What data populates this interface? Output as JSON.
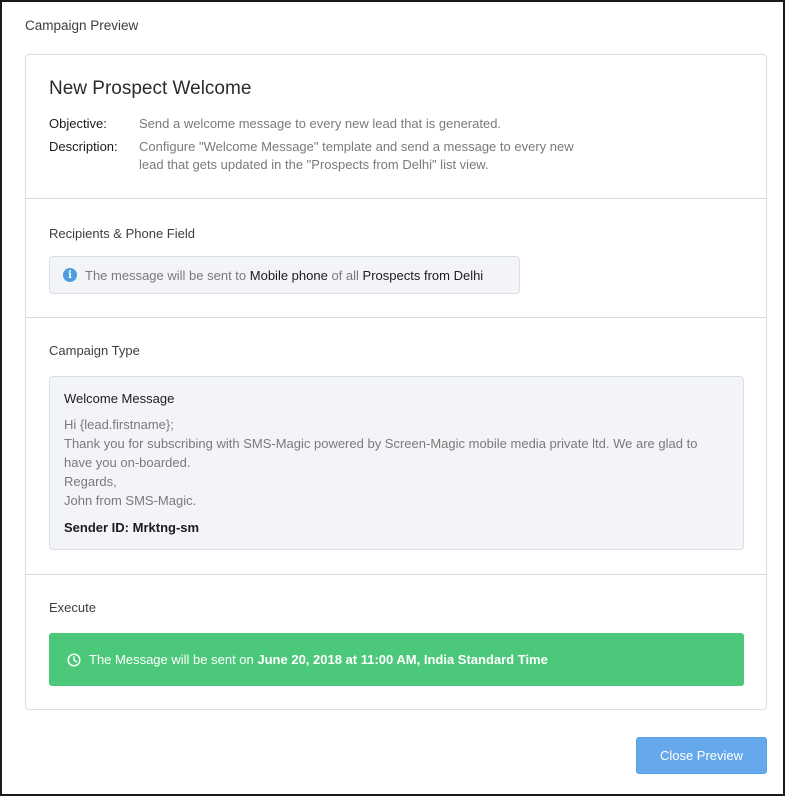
{
  "modal": {
    "title": "Campaign Preview"
  },
  "campaign": {
    "name": "New Prospect Welcome",
    "objective_label": "Objective:",
    "objective": "Send a welcome message to every new lead that is generated.",
    "description_label": "Description:",
    "description_line1": "Configure \"Welcome Message\" template and send a message to every new",
    "description_line2": "lead that gets updated in the \"Prospects from Delhi\" list view."
  },
  "recipients": {
    "heading": "Recipients & Phone Field",
    "icon": "info-icon",
    "text_prefix": "The message will be sent to",
    "phone_field": "Mobile phone",
    "text_middle": "of all",
    "list_view": "Prospects from Delhi"
  },
  "campaign_type": {
    "heading": "Campaign Type",
    "template_name": "Welcome Message",
    "body_lines": [
      "Hi {lead.firstname};",
      "Thank you for subscribing with SMS-Magic powered by Screen-Magic mobile media private ltd. We are glad to",
      "have you on-boarded.",
      "Regards,",
      "John from SMS-Magic."
    ],
    "sender_id": "Sender ID: Mrktng-sm"
  },
  "execute": {
    "heading": "Execute",
    "icon": "clock-icon",
    "text_prefix": "The Message will be sent on",
    "schedule": "June 20, 2018 at 11:00 AM, India Standard Time",
    "color": "#4bc87a"
  },
  "footer": {
    "close_label": "Close Preview",
    "button_color": "#65a9ec"
  }
}
